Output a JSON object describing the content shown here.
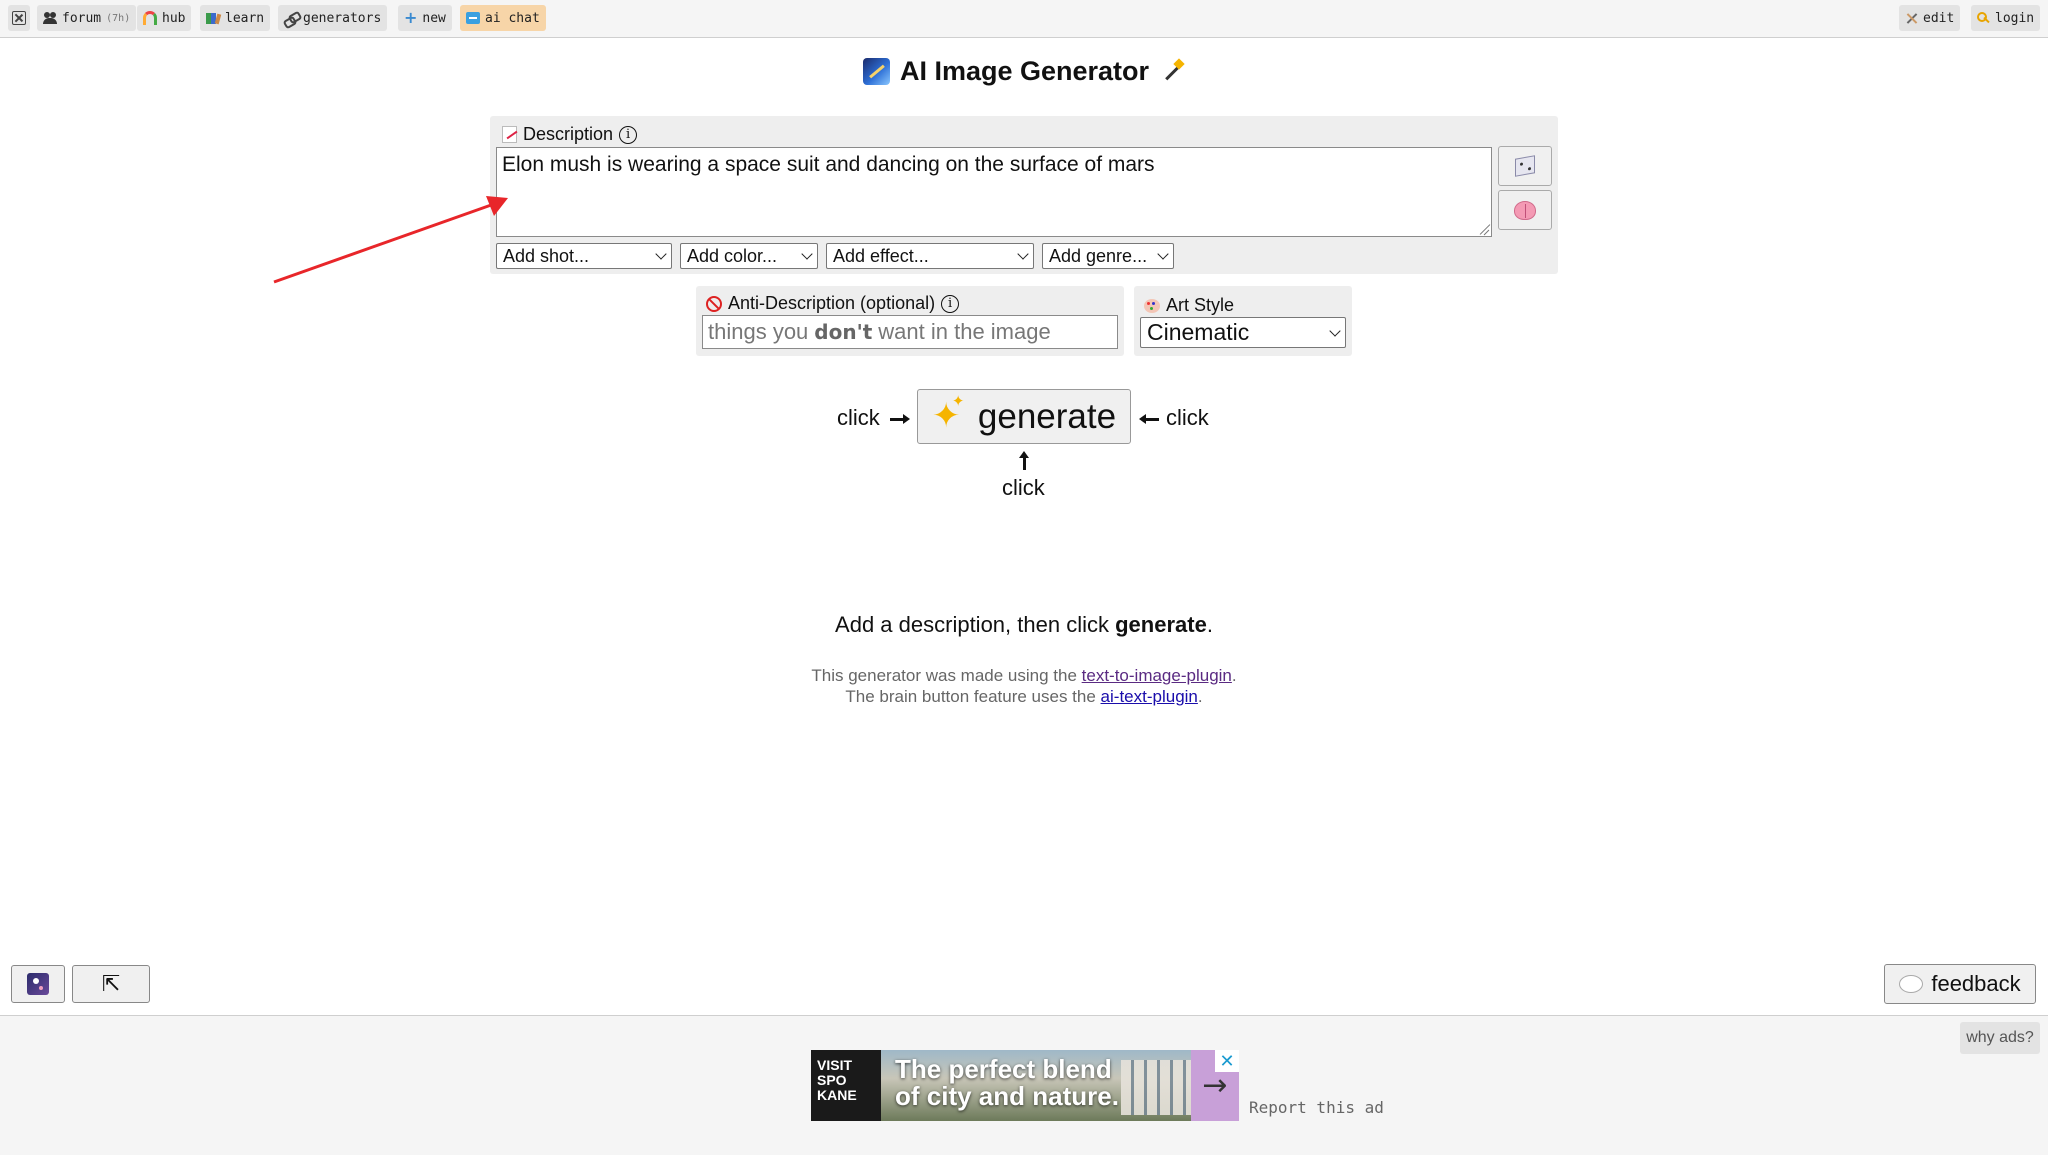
{
  "nav": {
    "items": [
      {
        "label": "forum",
        "count": "(7h)",
        "icon": "people-icon"
      },
      {
        "label": "hub",
        "icon": "rainbow-icon"
      },
      {
        "label": "learn",
        "icon": "books-icon"
      },
      {
        "label": "generators",
        "icon": "chain-icon"
      },
      {
        "label": "new",
        "icon": "plus-icon"
      },
      {
        "label": "ai chat",
        "icon": "chat-icon"
      }
    ],
    "right": [
      {
        "label": "edit",
        "icon": "tools-icon"
      },
      {
        "label": "login",
        "icon": "key-icon"
      }
    ]
  },
  "title": "AI Image Generator",
  "description": {
    "label": "Description",
    "value": "Elon mush is wearing a space suit and dancing on the surface of mars",
    "selects": [
      "Add shot...",
      "Add color...",
      "Add effect...",
      "Add genre..."
    ]
  },
  "anti": {
    "label": "Anti-Description (optional)",
    "placeholder_pre": "things you",
    "placeholder_bold": "don't",
    "placeholder_post": "want in the image"
  },
  "art_style": {
    "label": "Art Style",
    "value": "Cinematic"
  },
  "generate": {
    "label": "generate",
    "click_left": "click",
    "click_right": "click",
    "click_below": "click"
  },
  "hint": {
    "pre": "Add a description, then click ",
    "bold": "generate",
    "post": "."
  },
  "credits": {
    "line1_pre": "This generator was made using the ",
    "line1_link": "text-to-image-plugin",
    "line1_post": ".",
    "line2_pre": "The brain button feature uses the ",
    "line2_link": "ai-text-plugin",
    "line2_post": "."
  },
  "feedback": "feedback",
  "ads": {
    "why": "why ads?",
    "logo": "VISIT SPO KANE",
    "headline1": "The perfect blend",
    "headline2": "of city and nature.",
    "close": "✕",
    "report": "Report this ad"
  },
  "colors": {
    "accent_nav": "#f7d5a8",
    "annotation_arrow": "#e8262a",
    "link": "#1a0dab"
  }
}
